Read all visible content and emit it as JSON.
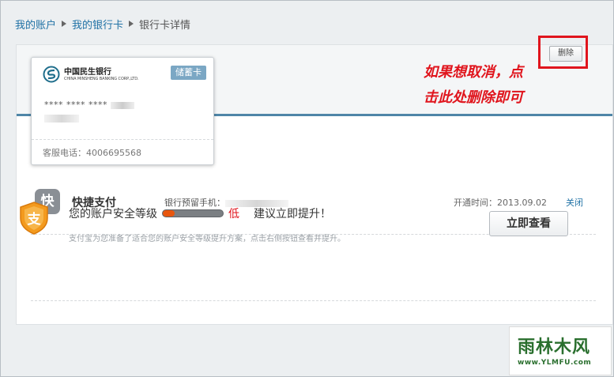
{
  "breadcrumb": {
    "items": [
      "我的账户",
      "我的银行卡"
    ],
    "current": "银行卡详情"
  },
  "card": {
    "bank_name": "中国民生银行",
    "bank_name_en": "CHINA MINSHENG BANKING CORP.,LTD.",
    "type": "储蓄卡",
    "number": "**** **** **** ",
    "phone": "客服电话：4006695568"
  },
  "annotation": {
    "line1": "如果想取消，点",
    "line2": "击此处删除即可"
  },
  "delete_label": "删除",
  "quickpay": {
    "icon_char": "快",
    "title": "快捷支付",
    "phone_label": "银行预留手机：",
    "opened": "开通时间：2013.09.02",
    "close_label": "关闭"
  },
  "security": {
    "icon_char": "支",
    "prefix": "您的账户安全等级",
    "level": "低",
    "level_fraction": 0.2,
    "suffix": "建议立即提升！",
    "description": "支付宝为您准备了适合您的账户安全等级提升方案，点击右侧按钮查看并提升。",
    "button": "立即查看"
  },
  "watermark": {
    "title": "雨林木风",
    "url": "www.YLMFU.com"
  },
  "colors": {
    "link": "#1f71a5",
    "accent_bar": "#4f86a8",
    "annotation_red": "#e0151d",
    "level_low": "#e8560e"
  }
}
